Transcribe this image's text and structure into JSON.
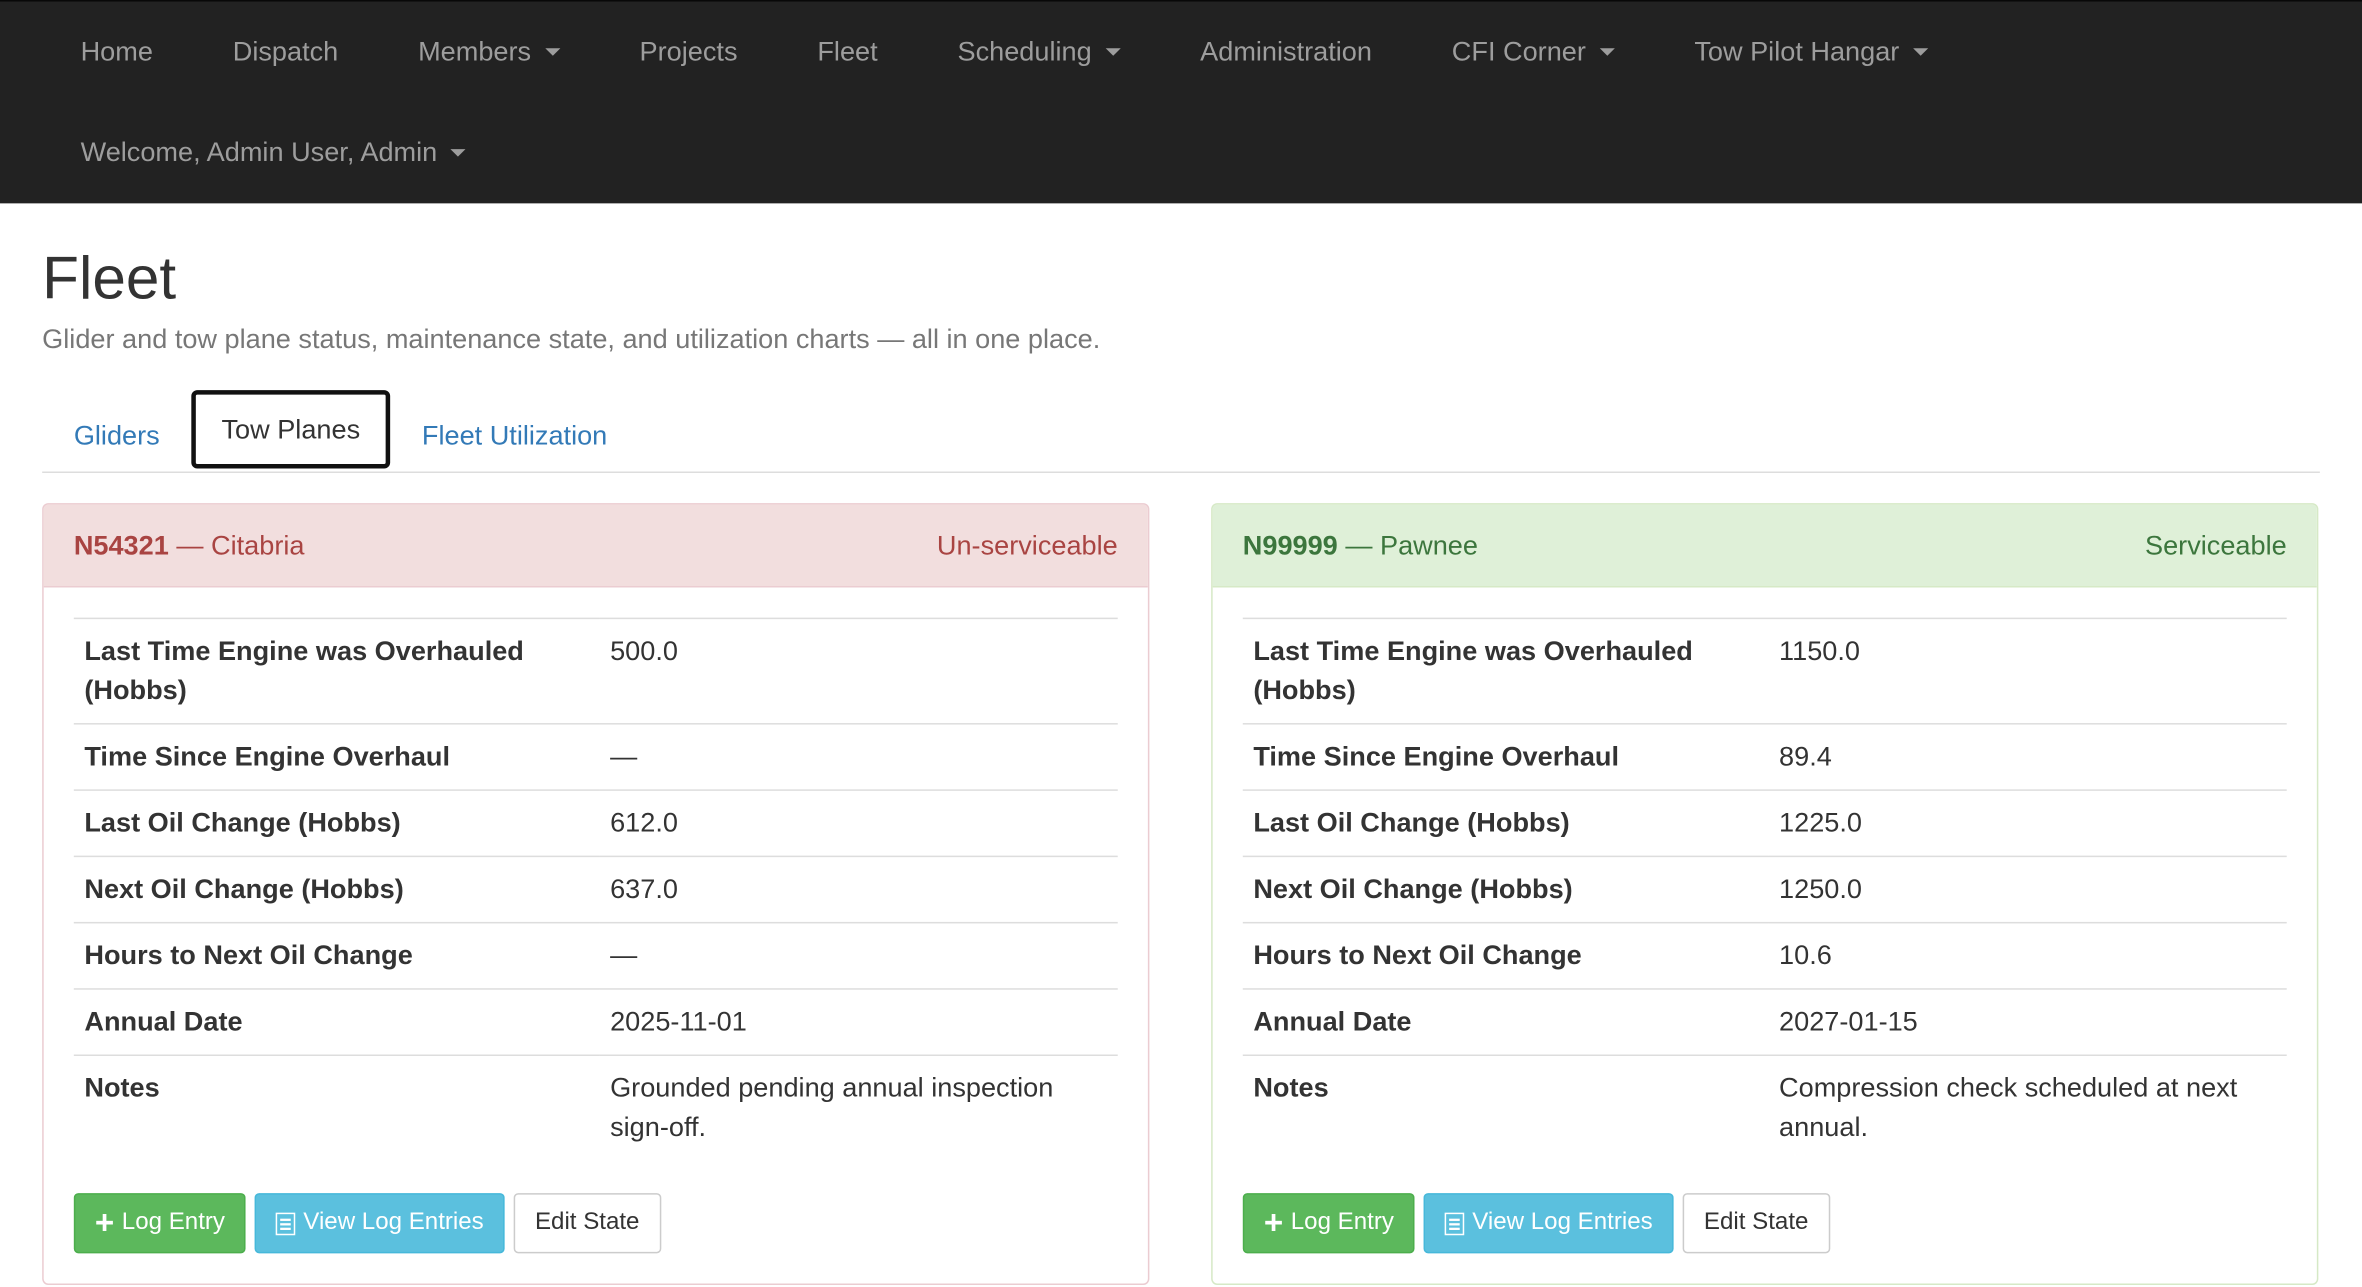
{
  "navbar": {
    "items": [
      {
        "label": "Home",
        "dropdown": false
      },
      {
        "label": "Dispatch",
        "dropdown": false
      },
      {
        "label": "Members",
        "dropdown": true
      },
      {
        "label": "Projects",
        "dropdown": false
      },
      {
        "label": "Fleet",
        "dropdown": false
      },
      {
        "label": "Scheduling",
        "dropdown": true
      },
      {
        "label": "Administration",
        "dropdown": false
      },
      {
        "label": "CFI Corner",
        "dropdown": true
      },
      {
        "label": "Tow Pilot Hangar",
        "dropdown": true
      }
    ],
    "welcome": "Welcome, Admin User, Admin"
  },
  "page": {
    "title": "Fleet",
    "subtitle": "Glider and tow plane status, maintenance state, and utilization charts — all in one place."
  },
  "tabs": [
    {
      "label": "Gliders",
      "active": false
    },
    {
      "label": "Tow Planes",
      "active": true
    },
    {
      "label": "Fleet Utilization",
      "active": false
    }
  ],
  "aircraft": [
    {
      "tail": "N54321",
      "model": "— Citabria",
      "status": "Un-serviceable",
      "status_color": "#a94442",
      "rows": [
        {
          "label": "Last Time Engine was Overhauled (Hobbs)",
          "value": "500.0"
        },
        {
          "label": "Time Since Engine Overhaul",
          "value": "—"
        },
        {
          "label": "Last Oil Change (Hobbs)",
          "value": "612.0"
        },
        {
          "label": "Next Oil Change (Hobbs)",
          "value": "637.0"
        },
        {
          "label": "Hours to Next Oil Change",
          "value": "—"
        },
        {
          "label": "Annual Date",
          "value": "2025-11-01"
        },
        {
          "label": "Notes",
          "value": "Grounded pending annual inspection sign-off."
        }
      ]
    },
    {
      "tail": "N99999",
      "model": "— Pawnee",
      "status": "Serviceable",
      "status_color": "#3c763d",
      "rows": [
        {
          "label": "Last Time Engine was Overhauled (Hobbs)",
          "value": "1150.0"
        },
        {
          "label": "Time Since Engine Overhaul",
          "value": "89.4"
        },
        {
          "label": "Last Oil Change (Hobbs)",
          "value": "1225.0"
        },
        {
          "label": "Next Oil Change (Hobbs)",
          "value": "1250.0"
        },
        {
          "label": "Hours to Next Oil Change",
          "value": "10.6"
        },
        {
          "label": "Annual Date",
          "value": "2027-01-15"
        },
        {
          "label": "Notes",
          "value": "Compression check scheduled at next annual."
        }
      ]
    }
  ],
  "buttons": {
    "log_entry": "Log Entry",
    "view_log_entries": "View Log Entries",
    "edit_state": "Edit State"
  },
  "icons": {
    "add": "plus-icon",
    "list": "list-icon",
    "dropdown": "caret-down-icon"
  }
}
